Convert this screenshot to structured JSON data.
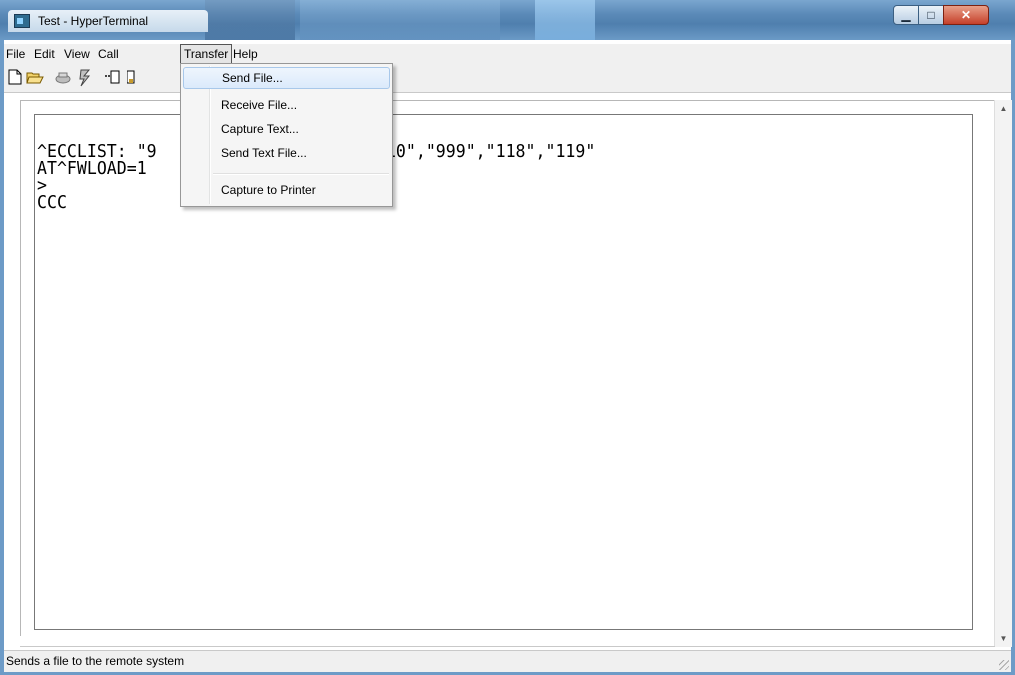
{
  "window": {
    "title": "Test - HyperTerminal",
    "controls": {
      "minimize": "▁",
      "maximize": "□",
      "close": "✕"
    }
  },
  "menubar": {
    "items": [
      "File",
      "Edit",
      "View",
      "Call",
      "Transfer",
      "Help"
    ],
    "active": "Transfer"
  },
  "toolbar": {
    "icons": [
      "new-icon",
      "open-icon",
      "connect-icon",
      "disconnect-icon",
      "send-icon",
      "receive-icon"
    ]
  },
  "terminal": {
    "lines": [
      "^ECCLIST: \"9                  3\",\"110\",\"999\",\"118\",\"119\"",
      "AT^FWLOAD=1",
      ">",
      "CCC"
    ]
  },
  "transfer_menu": {
    "items": [
      "Send File...",
      "Receive File...",
      "Capture Text...",
      "Send Text File...",
      "Capture to Printer"
    ],
    "highlighted": "Send File..."
  },
  "statusbar": {
    "text": "Sends a file to the remote system"
  },
  "colors": {
    "titlebar": "#5b8ab8",
    "menu_bg": "#f0f0f0",
    "highlight": "#dbeafb"
  }
}
